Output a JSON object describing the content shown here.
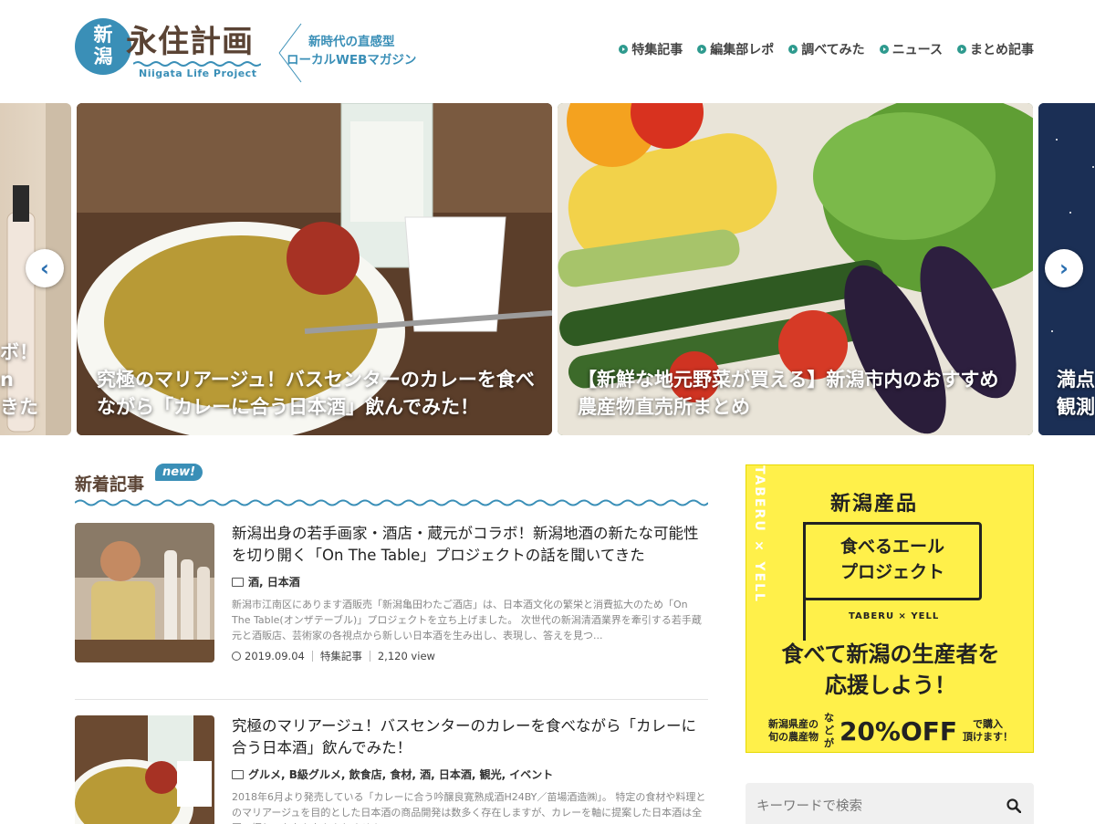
{
  "header": {
    "logo_niigata": "新\n潟",
    "logo_main": "永住計画",
    "logo_sub": "Niigata Life Project",
    "tagline": "新時代の直感型\nローカルWEBマガジン",
    "nav": [
      "特集記事",
      "編集部レポ",
      "調べてみた",
      "ニュース",
      "まとめ記事"
    ]
  },
  "slider": {
    "left_partial": "ボ！\nn\nきた",
    "slides": [
      {
        "title": "究極のマリアージュ！バスセンターのカレーを食べながら「カレーに合う日本酒」飲んでみた！"
      },
      {
        "title": "【新鮮な地元野菜が買える】新潟市内のおすすめ農産物直売所まとめ"
      }
    ],
    "right_partial": "満点\n観測",
    "prev": "‹",
    "next": "›"
  },
  "new_articles": {
    "heading": "新着記事",
    "badge": "new!",
    "items": [
      {
        "title": "新潟出身の若手画家・酒店・蔵元がコラボ！新潟地酒の新たな可能性を切り開く「On The Table」プロジェクトの話を聞いてきた",
        "categories": "酒, 日本酒",
        "excerpt": "新潟市江南区にあります酒販売「新潟亀田わたご酒店」は、日本酒文化の繁栄と消費拡大のため「On The Table(オンザテーブル)」プロジェクトを立ち上げました。 次世代の新潟清酒業界を牽引する若手蔵元と酒販店、芸術家の各視点から新しい日本酒を生み出し、表現し、答えを見つ...",
        "date": "2019.09.04",
        "category_label": "特集記事",
        "views": "2,120 view"
      },
      {
        "title": "究極のマリアージュ！バスセンターのカレーを食べながら「カレーに合う日本酒」飲んでみた！",
        "categories": "グルメ, B級グルメ, 飲食店, 食材, 酒, 日本酒, 観光, イベント",
        "excerpt": "2018年6月より発売している「カレーに合う吟醸良寛熟成酒H24BY／苗場酒造㈱」。 特定の食材や料理とのマリアージュを目的とした日本酒の商品開発は数多く存在しますが、カレーを軸に提案した日本酒は全国で探してもなかなかありません。"
      }
    ]
  },
  "ad": {
    "vertical": "TABERU × YELL",
    "top": "新潟産品",
    "flag": "食べるエール\nプロジェクト",
    "brand": "TABERU × YELL",
    "main": "食べて新潟の生産者を\n応援しよう！",
    "small_left": "新潟県産の\n旬の農産物",
    "small_mid": "な\nど\nが",
    "big": "20%OFF",
    "small_right": "で購入\n頂けます！"
  },
  "search": {
    "placeholder": "キーワードで検索"
  },
  "colors": {
    "brand_blue": "#3a8fb7",
    "brand_brown": "#5a4334",
    "nav_dot": "#2e9a8e",
    "ad_yellow": "#fff04a"
  }
}
